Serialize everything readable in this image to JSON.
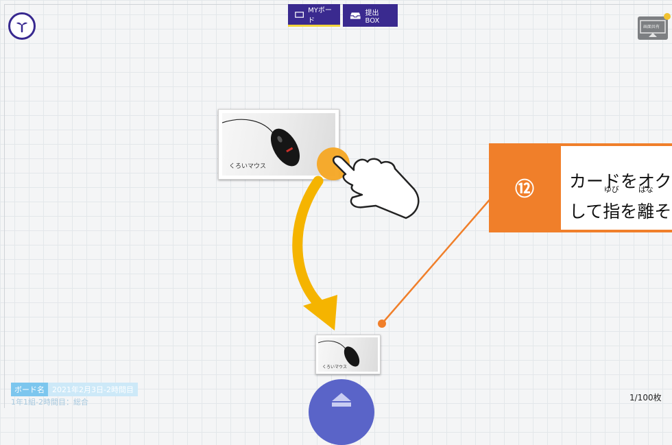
{
  "header": {
    "tabs": [
      {
        "label": "MYボード"
      },
      {
        "label": "提出BOX"
      }
    ],
    "share_button_label": "画面共有"
  },
  "board": {
    "cards": [
      {
        "caption": "くろいマウス"
      },
      {
        "caption": "くろいマウス"
      }
    ]
  },
  "callout": {
    "step": "⑫",
    "line1": "カードをオク",
    "line2_pre": "して",
    "line2_k1": "指",
    "line2_r1": "ゆび",
    "line2_mid": "を",
    "line2_k2": "離",
    "line2_r2": "はな",
    "line2_post": "そ"
  },
  "footer": {
    "board_name_key": "ボード名",
    "board_name_value": "2021年2月3日-2時間目",
    "class_info": "1年1組-2時間目：総合",
    "card_count": "1/100枚"
  },
  "colors": {
    "brand": "#3a2a8f",
    "accent": "#f07f2a",
    "arrow": "#f5b400"
  }
}
